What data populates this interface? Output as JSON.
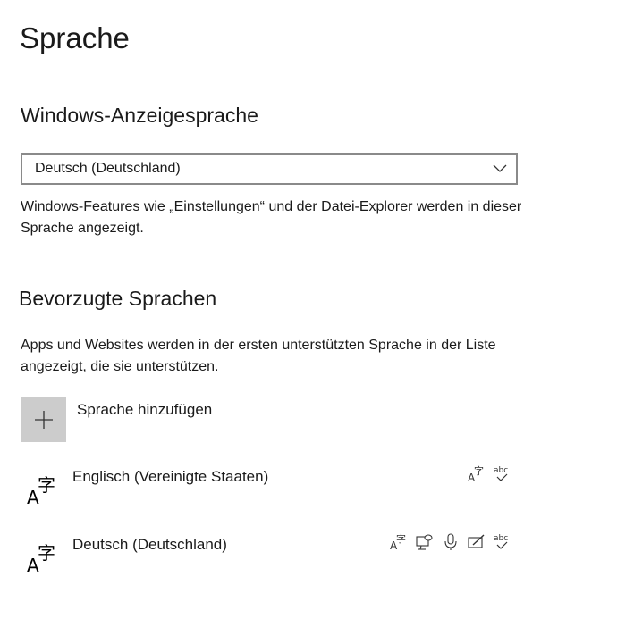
{
  "page": {
    "title": "Sprache"
  },
  "display_language": {
    "heading": "Windows-Anzeigesprache",
    "selected": "Deutsch (Deutschland)",
    "description": "Windows-Features wie „Einstellungen“ und der Datei-Explorer werden in dieser Sprache angezeigt."
  },
  "preferred": {
    "heading": "Bevorzugte Sprachen",
    "description": "Apps und Websites werden in der ersten unterstützten Sprache in der Liste angezeigt, die sie unterstützen.",
    "add_label": "Sprache hinzufügen",
    "languages": [
      {
        "name": "Englisch (Vereinigte Staaten)",
        "features": [
          "language-pack-icon",
          "spellcheck-icon"
        ]
      },
      {
        "name": "Deutsch (Deutschland)",
        "features": [
          "language-pack-icon",
          "text-to-speech-icon",
          "speech-recognition-icon",
          "handwriting-icon",
          "spellcheck-icon"
        ]
      }
    ]
  },
  "icons": {
    "add": "plus-icon",
    "language": "language-icon",
    "dropdown": "chevron-down-icon"
  },
  "colors": {
    "add_button_bg": "#cccccc",
    "dropdown_border": "#8a8a8a",
    "text": "#1a1a1a"
  }
}
